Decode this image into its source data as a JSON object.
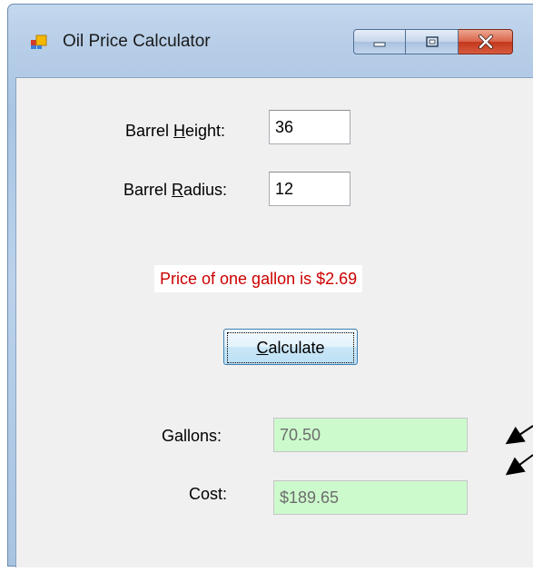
{
  "window": {
    "title": "Oil Price Calculator"
  },
  "form": {
    "barrel_height": {
      "prefix": "Barrel ",
      "accel": "H",
      "suffix": "eight:",
      "value": "36"
    },
    "barrel_radius": {
      "prefix": "Barrel ",
      "accel": "R",
      "suffix": "adius:",
      "value": "12"
    },
    "price_message": "Price of one gallon is $2.69",
    "calculate_button": {
      "prefix": "",
      "accel": "C",
      "suffix": "alculate"
    },
    "gallons": {
      "label": "Gallons:",
      "value": "70.50"
    },
    "cost": {
      "label": "Cost:",
      "value": "$189.65"
    }
  },
  "colors": {
    "price_text": "#cc0000",
    "readonly_bg": "#cdfacd"
  },
  "icons": {
    "app": "app-icon",
    "minimize": "minimize-icon",
    "maximize": "maximize-icon",
    "close": "close-icon"
  }
}
